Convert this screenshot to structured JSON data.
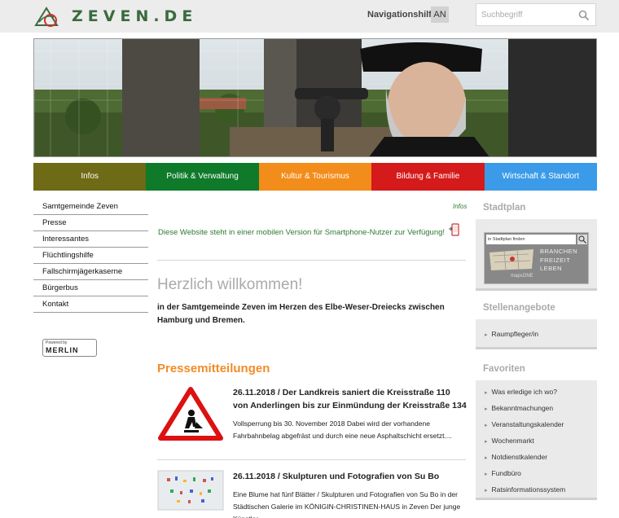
{
  "header": {
    "logo_text": "ZEVEN.DE",
    "nav_help": "Navigationshilfe",
    "an_label": "AN",
    "search_placeholder": "Suchbegriff"
  },
  "main_nav": [
    {
      "label": "Infos",
      "color": "#6e6a15"
    },
    {
      "label": "Politik & Verwaltung",
      "color": "#0e7a2a"
    },
    {
      "label": "Kultur & Tourismus",
      "color": "#f28c1a"
    },
    {
      "label": "Bildung & Familie",
      "color": "#d41a1a"
    },
    {
      "label": "Wirtschaft & Standort",
      "color": "#3c9be8"
    }
  ],
  "left_nav": [
    "Samtgemeinde Zeven",
    "Presse",
    "Interessantes",
    "Flüchtlingshilfe",
    "Fallschirmjägerkaserne",
    "Bürgerbus",
    "Kontakt"
  ],
  "powered_by": {
    "small": "Powered by",
    "big": "MERLIN"
  },
  "content": {
    "crumb": "Infos",
    "mobile_note": "Diese Website steht in einer mobilen Version für Smartphone-Nutzer zur Verfügung!",
    "welcome": "Herzlich willkommen!",
    "intro": "in der Samtgemeinde Zeven im Herzen des Elbe-Weser-Dreiecks zwischen Hamburg und Bremen.",
    "press_title": "Pressemitteilungen",
    "news": [
      {
        "headline": "26.11.2018 / Der Landkreis saniert die Kreisstraße 110 von Anderlingen bis zur Einmündung der Kreisstraße 134",
        "teaser": "Vollsperrung bis 30. November 2018 Dabei wird der vorhandene Fahrbahnbelag abgefräst und durch eine neue Asphaltschicht ersetzt...."
      },
      {
        "headline": "26.11.2018 / Skulpturen und Fotografien von Su Bo",
        "teaser": "Eine Blume hat fünf Blätter / Skulpturen und Fotografien von Su Bo in der Städtischen Galerie im KÖNIGIN-CHRISTINEN-HAUS in Zeven Der junge Künstler..."
      }
    ]
  },
  "sidebar": {
    "stadtplan": {
      "title": "Stadtplan",
      "search_label": "in Stadtplan finden",
      "words": [
        "BRANCHEN",
        "FREIZEIT",
        "LEBEN"
      ],
      "brand": "mapsONE"
    },
    "stellen": {
      "title": "Stellenangebote",
      "items": [
        "Raumpfleger/in"
      ]
    },
    "favoriten": {
      "title": "Favoriten",
      "items": [
        "Was erledige ich wo?",
        "Bekanntmachungen",
        "Veranstaltungskalender",
        "Wochenmarkt",
        "Notdienstkalender",
        "Fundbüro",
        "Ratsinformationssystem"
      ]
    }
  }
}
